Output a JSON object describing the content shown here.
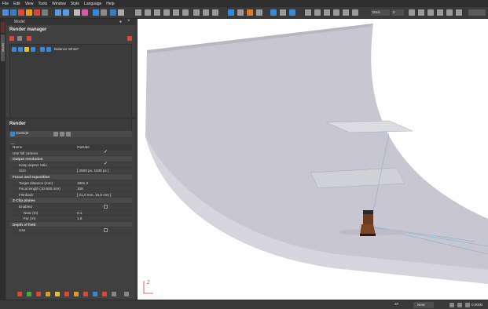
{
  "menu": [
    "File",
    "Edit",
    "View",
    "Tools",
    "Window",
    "Style",
    "Language",
    "Help"
  ],
  "toolbar": {
    "zoom_value": "0m/s",
    "zoom_value2": "0"
  },
  "dock_tab": "Model",
  "panels": {
    "header_label": "Model",
    "render_manager": {
      "title": "Render manager",
      "item_label": "Balance White*"
    },
    "render": {
      "title": "Render",
      "preset": "Outside"
    }
  },
  "properties": {
    "header_name": "Name",
    "header_value": "Outside",
    "rows": [
      {
        "k": "Use full camera",
        "v": "✓",
        "type": "item"
      },
      {
        "k": "Output resolution",
        "v": "",
        "type": "group"
      },
      {
        "k": "Keep aspect ratio",
        "v": "✓",
        "type": "sub"
      },
      {
        "k": "Size",
        "v": "[ 2508 px, 1638 px ]",
        "type": "sub"
      },
      {
        "k": "Focus and exposition",
        "v": "",
        "type": "group"
      },
      {
        "k": "Target distance (mm)",
        "v": "1861,3",
        "type": "sub"
      },
      {
        "k": "Focal length (10-500 mm)",
        "v": "108",
        "type": "sub"
      },
      {
        "k": "Filmback",
        "v": "[ 21,0 mm, 15,8 mm ]",
        "type": "sub"
      },
      {
        "k": "Z-Clip planes",
        "v": "",
        "type": "group"
      },
      {
        "k": "Enabled",
        "v": "",
        "type": "sub"
      },
      {
        "k": "Near (m)",
        "v": "0,1",
        "type": "sub"
      },
      {
        "k": "Far (m)",
        "v": "1,5",
        "type": "sub"
      },
      {
        "k": "Depth of field",
        "v": "",
        "type": "group"
      },
      {
        "k": "Use",
        "v": "",
        "type": "sub"
      }
    ]
  },
  "statusbar": {
    "count": "37",
    "near_label": "Near",
    "value": "0,0000"
  },
  "viewport": {
    "axis_label": "Z"
  }
}
